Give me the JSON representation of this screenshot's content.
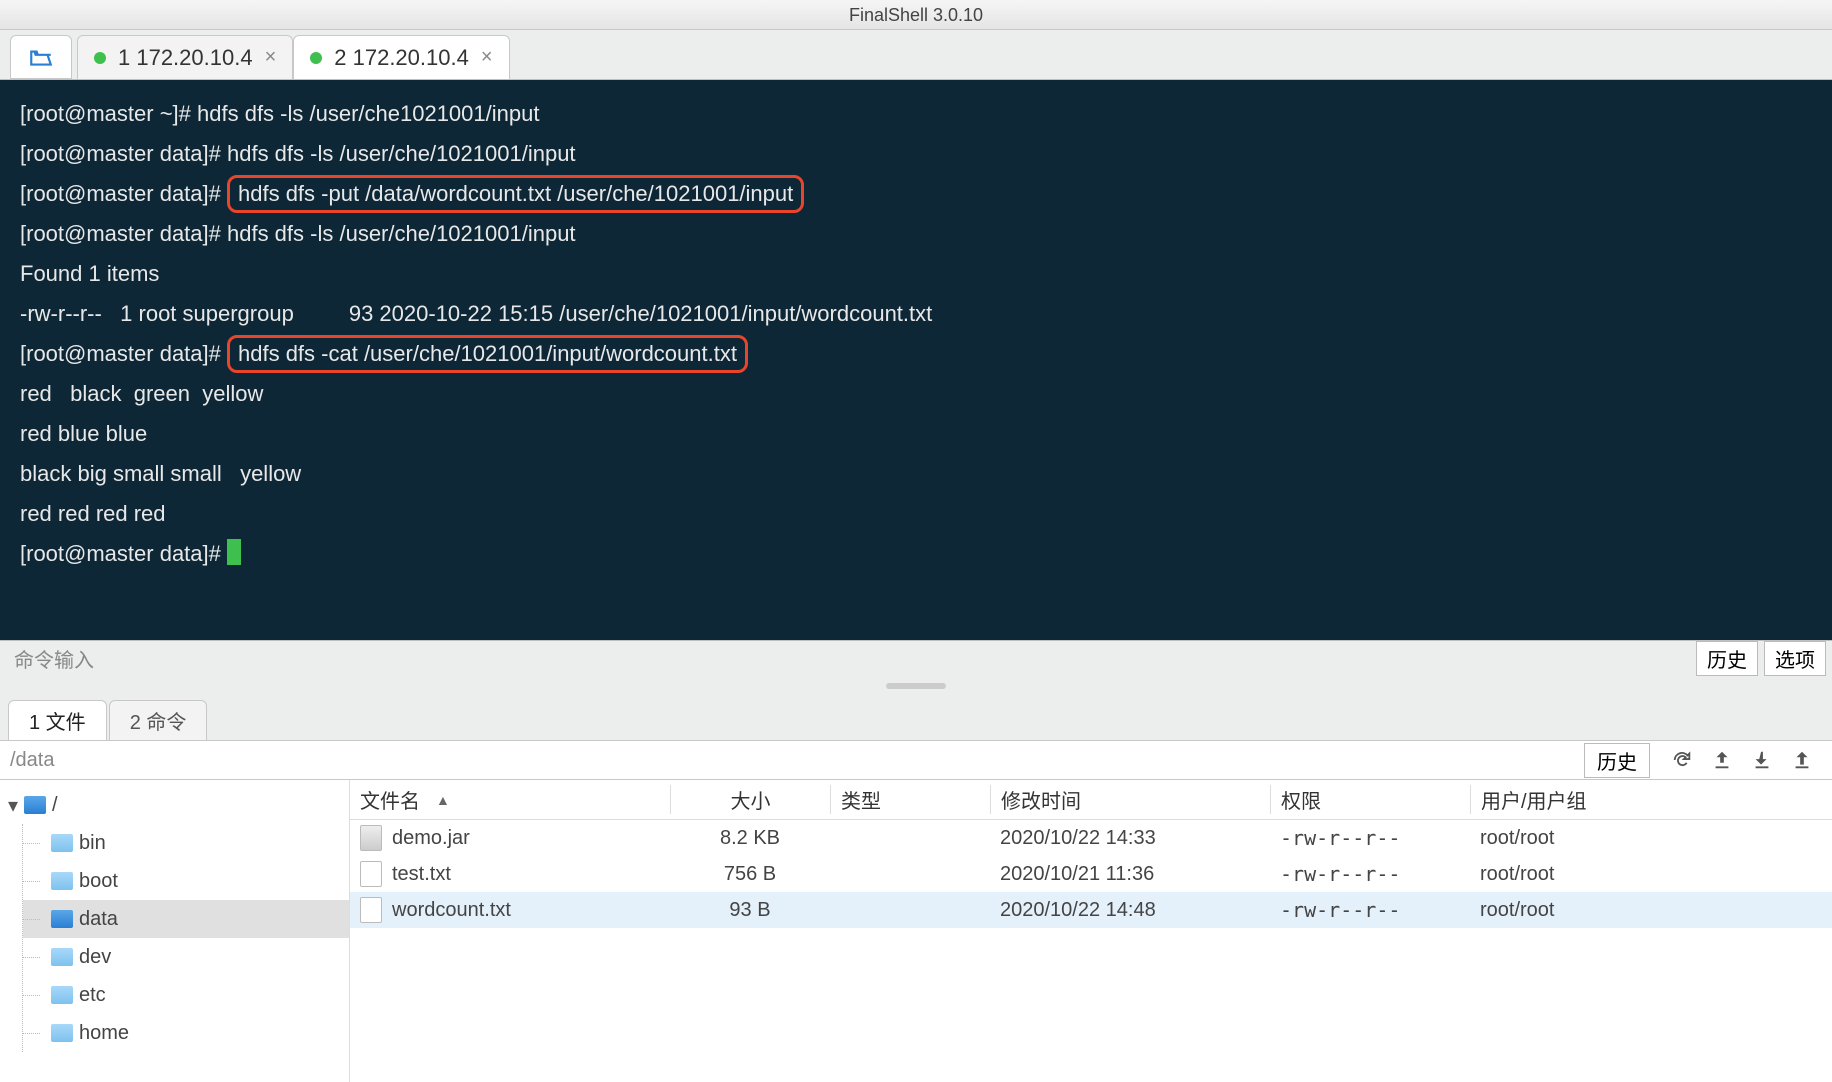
{
  "app": {
    "title": "FinalShell 3.0.10"
  },
  "tabs": [
    {
      "label": "1 172.20.10.4",
      "active": false
    },
    {
      "label": "2 172.20.10.4",
      "active": true
    }
  ],
  "terminal": {
    "lines": [
      {
        "prompt": "[root@master ~]#",
        "cmd": " hdfs dfs -ls /user/che1021001/input",
        "hl": false
      },
      {
        "prompt": "[root@master data]#",
        "cmd": " hdfs dfs -ls /user/che/1021001/input",
        "hl": false
      },
      {
        "prompt": "[root@master data]#",
        "cmd": "hdfs dfs -put /data/wordcount.txt /user/che/1021001/input",
        "hl": true
      },
      {
        "prompt": "[root@master data]#",
        "cmd": " hdfs dfs -ls /user/che/1021001/input",
        "hl": false
      },
      {
        "text": "Found 1 items"
      },
      {
        "text": "-rw-r--r--   1 root supergroup         93 2020-10-22 15:15 /user/che/1021001/input/wordcount.txt"
      },
      {
        "prompt": "[root@master data]#",
        "cmd": "hdfs dfs -cat /user/che/1021001/input/wordcount.txt",
        "hl": true
      },
      {
        "text": "red   black  green  yellow"
      },
      {
        "text": "red blue blue"
      },
      {
        "text": "black big small small   yellow"
      },
      {
        "text": "red red red red"
      },
      {
        "prompt": "[root@master data]# ",
        "cursor": true
      }
    ]
  },
  "cmd_input": {
    "placeholder": "命令输入",
    "history_btn": "历史",
    "options_btn": "选项"
  },
  "bottom_panel": {
    "tabs": [
      {
        "label": "1 文件",
        "active": true
      },
      {
        "label": "2 命令",
        "active": false
      }
    ],
    "path": "/data",
    "history_btn": "历史",
    "columns": {
      "name": "文件名",
      "size": "大小",
      "type": "类型",
      "date": "修改时间",
      "perm": "权限",
      "user": "用户/用户组"
    },
    "tree": {
      "root": "/",
      "children": [
        {
          "name": "bin"
        },
        {
          "name": "boot"
        },
        {
          "name": "data",
          "selected": true
        },
        {
          "name": "dev"
        },
        {
          "name": "etc"
        },
        {
          "name": "home"
        }
      ]
    },
    "files": [
      {
        "name": "demo.jar",
        "icon": "jar",
        "size": "8.2 KB",
        "type": "",
        "date": "2020/10/22 14:33",
        "perm": "-rw-r--r--",
        "user": "root/root",
        "selected": false
      },
      {
        "name": "test.txt",
        "icon": "txt",
        "size": "756 B",
        "type": "",
        "date": "2020/10/21 11:36",
        "perm": "-rw-r--r--",
        "user": "root/root",
        "selected": false
      },
      {
        "name": "wordcount.txt",
        "icon": "txt",
        "size": "93 B",
        "type": "",
        "date": "2020/10/22 14:48",
        "perm": "-rw-r--r--",
        "user": "root/root",
        "selected": true
      }
    ]
  }
}
